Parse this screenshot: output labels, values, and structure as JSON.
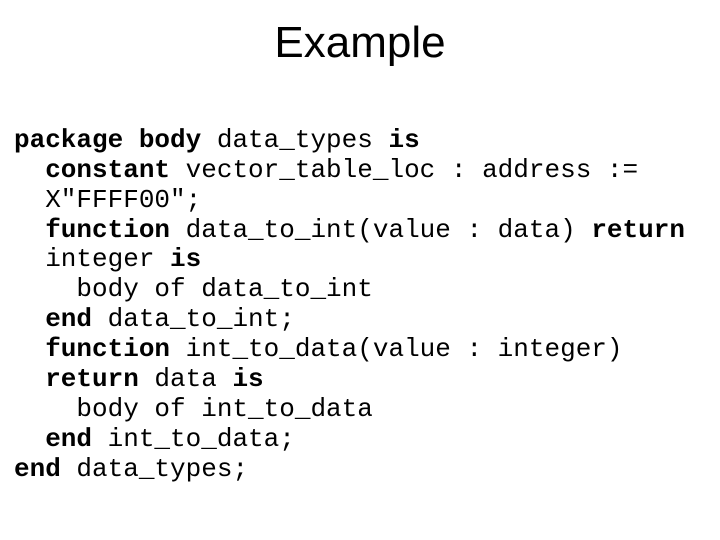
{
  "title": "Example",
  "code": {
    "l1_kw": "package body",
    "l1_rest": " data_types ",
    "l1_is": "is",
    "l2_kw": "constant",
    "l2_rest": " vector_table_loc : address := X\"FFFF00\";",
    "l3_kw": "function",
    "l3_mid": " data_to_int(value : data) ",
    "l3_ret": "return",
    "l3_after": " integer ",
    "l3_is": "is",
    "l4": "body of data_to_int",
    "l5_kw": "end",
    "l5_rest": " data_to_int;",
    "l6_kw": "function",
    "l6_mid": " int_to_data(value : integer) ",
    "l6_ret": "return",
    "l6_after": " data ",
    "l6_is": "is",
    "l7": "body of int_to_data",
    "l8_kw": "end",
    "l8_rest": " int_to_data;",
    "l9_kw": "end",
    "l9_rest": " data_types;"
  }
}
